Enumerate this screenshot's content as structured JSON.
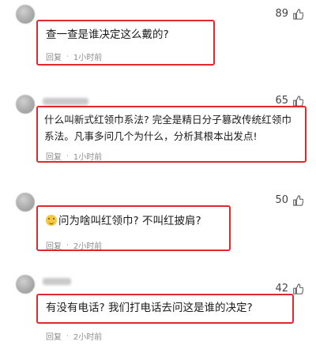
{
  "comments": [
    {
      "likes": "89",
      "text": "查一查是谁决定这么戴的?",
      "reply_label": "回复",
      "time": "1小时前"
    },
    {
      "likes": "65",
      "text_line1": "什么叫新式红领巾系法? 完全是精日分子篡改传统红领巾",
      "text_line2": "系法。凡事多问几个为什么，分析其根本出发点!",
      "reply_label": "回复",
      "time": "1小时前"
    },
    {
      "likes": "50",
      "text": "问为啥叫红领巾? 不叫红披肩?",
      "reply_label": "回复",
      "time": "2小时前"
    },
    {
      "likes": "42",
      "text": "有没有电话? 我们打电话去问这是谁的决定?",
      "reply_label": "回复",
      "time": "2小时前"
    }
  ],
  "separator": "·",
  "highlight_color": "#e0282e"
}
